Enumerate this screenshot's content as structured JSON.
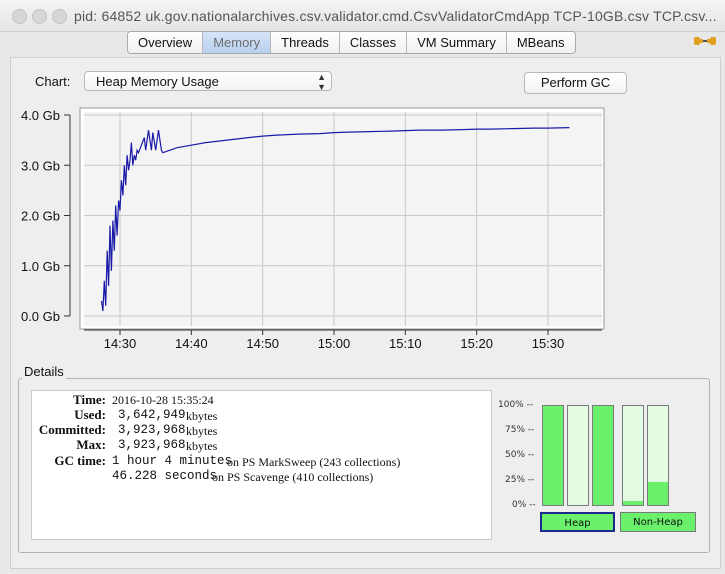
{
  "window": {
    "title": "pid: 64852 uk.gov.nationalarchives.csv.validator.cmd.CsvValidatorCmdApp TCP-10GB.csv TCP.csv..."
  },
  "tabs": [
    {
      "label": "Overview",
      "selected": false
    },
    {
      "label": "Memory",
      "selected": true
    },
    {
      "label": "Threads",
      "selected": false
    },
    {
      "label": "Classes",
      "selected": false
    },
    {
      "label": "VM Summary",
      "selected": false
    },
    {
      "label": "MBeans",
      "selected": false
    }
  ],
  "controls": {
    "chart_label": "Chart:",
    "chart_select_value": "Heap Memory Usage",
    "perform_gc_label": "Perform GC"
  },
  "chart_data": {
    "type": "line",
    "yticks": [
      "0.0 Gb",
      "1.0 Gb",
      "2.0 Gb",
      "3.0 Gb",
      "4.0 Gb"
    ],
    "ylim": [
      0,
      4.0
    ],
    "xticks": [
      "14:30",
      "14:40",
      "14:50",
      "15:00",
      "15:10",
      "15:20",
      "15:30"
    ],
    "xlim": [
      "14:27",
      "14:34"
    ],
    "grid": true,
    "series": [
      {
        "color": "#1a1aa8",
        "x": [
          "14:27:24",
          "14:27:36",
          "14:27:48",
          "14:28:00",
          "14:28:12",
          "14:28:24",
          "14:28:36",
          "14:28:48",
          "14:29:00",
          "14:29:12",
          "14:29:24",
          "14:29:36",
          "14:29:48",
          "14:30:00",
          "14:30:12",
          "14:30:24",
          "14:30:36",
          "14:30:48",
          "14:31:00",
          "14:31:12",
          "14:31:24",
          "14:31:36",
          "14:31:48",
          "14:32:00",
          "14:32:12",
          "14:32:24",
          "14:32:36",
          "14:33:00",
          "14:33:24",
          "14:33:36",
          "14:34:00",
          "14:34:24",
          "14:34:36",
          "14:35:00",
          "14:35:24",
          "14:35:48",
          "14:36:00",
          "14:37:00",
          "14:38:00",
          "14:40:00",
          "14:42:00",
          "14:45:00",
          "14:48:00",
          "14:50:00",
          "14:52:00",
          "14:55:00",
          "14:58:00",
          "15:00:00",
          "15:02:00",
          "15:05:00",
          "15:08:00",
          "15:10:00",
          "15:12:00",
          "15:15:00",
          "15:18:00",
          "15:20:00",
          "15:22:00",
          "15:25:00",
          "15:28:00",
          "15:30:00",
          "15:33:00"
        ],
        "y": [
          0.3,
          0.1,
          0.7,
          0.2,
          1.3,
          0.6,
          1.8,
          0.9,
          1.9,
          1.3,
          2.2,
          1.6,
          2.3,
          2.1,
          2.7,
          2.4,
          3.0,
          2.6,
          3.2,
          2.9,
          3.1,
          3.45,
          3.0,
          3.2,
          3.1,
          3.3,
          3.25,
          3.4,
          3.55,
          3.3,
          3.7,
          3.3,
          3.65,
          3.3,
          3.7,
          3.3,
          3.25,
          3.3,
          3.35,
          3.4,
          3.45,
          3.5,
          3.55,
          3.58,
          3.6,
          3.62,
          3.63,
          3.65,
          3.66,
          3.67,
          3.68,
          3.69,
          3.7,
          3.7,
          3.71,
          3.72,
          3.72,
          3.73,
          3.74,
          3.74,
          3.75
        ]
      }
    ]
  },
  "details": {
    "title": "Details",
    "time_label": "Time:",
    "time_value": "2016-10-28 15:35:24",
    "used_label": "Used:",
    "used_value": "3,642,949",
    "used_unit": "kbytes",
    "committed_label": "Committed:",
    "committed_value": "3,923,968",
    "committed_unit": "kbytes",
    "max_label": "Max:",
    "max_value": "3,923,968",
    "max_unit": "kbytes",
    "gc_label": "GC time:",
    "gc1_value": "1 hour 4 minutes",
    "gc1_desc": "on PS MarkSweep (243 collections)",
    "gc2_value": "46.228 seconds",
    "gc2_desc": "on PS Scavenge (410 collections)"
  },
  "pools": {
    "pct_labels": [
      "100% --",
      "75% --",
      "50% --",
      "25% --",
      "0% --"
    ],
    "heap_label": "Heap",
    "nonheap_label": "Non-Heap",
    "heap_fill": [
      1.0,
      0.0,
      1.0
    ],
    "nonheap_fill": [
      0.04,
      0.23
    ],
    "fill_color": "#6af06a",
    "empty_color": "#e2fbe2"
  }
}
